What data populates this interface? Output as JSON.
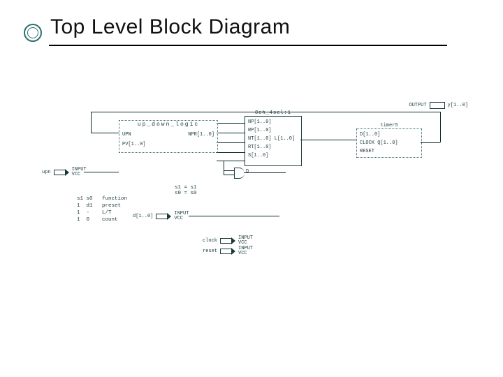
{
  "slide": {
    "title": "Top Level Block Diagram"
  },
  "blocks": {
    "up_down_logic": {
      "title": "up_down_logic",
      "ports": {
        "upn": "UPN",
        "npr": "NPR[1..0]",
        "pv": "PV[1..0]"
      }
    },
    "sel": {
      "title": "8ch_4sel:1",
      "rows": [
        "NP[1..0]",
        "RP[1..0]",
        "NT[1..0]    L[1..0]",
        "RT[1..0]",
        "S[1..0]"
      ]
    },
    "timer": {
      "title": "timer5",
      "rows": [
        "D[1..0]",
        "CLOCK     Q[1..0]",
        "RESET"
      ]
    }
  },
  "pins": {
    "upn": {
      "name": "upn",
      "type": "INPUT",
      "net": "VCC"
    },
    "d": {
      "name": "d[1..0]",
      "type": "INPUT",
      "net": "VCC"
    },
    "clock": {
      "name": "clock",
      "type": "INPUT",
      "net": "VCC"
    },
    "reset": {
      "name": "reset",
      "type": "INPUT",
      "net": "VCC"
    }
  },
  "output": {
    "type": "OUTPUT",
    "name": "y[1..0]"
  },
  "gate": {
    "label": "D"
  },
  "notes": {
    "eq1": "s1 = s1",
    "eq2": "s0 = s0"
  },
  "function_table": {
    "header": "s1 s0   function",
    "rows": [
      "1  d1   preset",
      "1  -    L/T",
      "1  0    count"
    ]
  }
}
